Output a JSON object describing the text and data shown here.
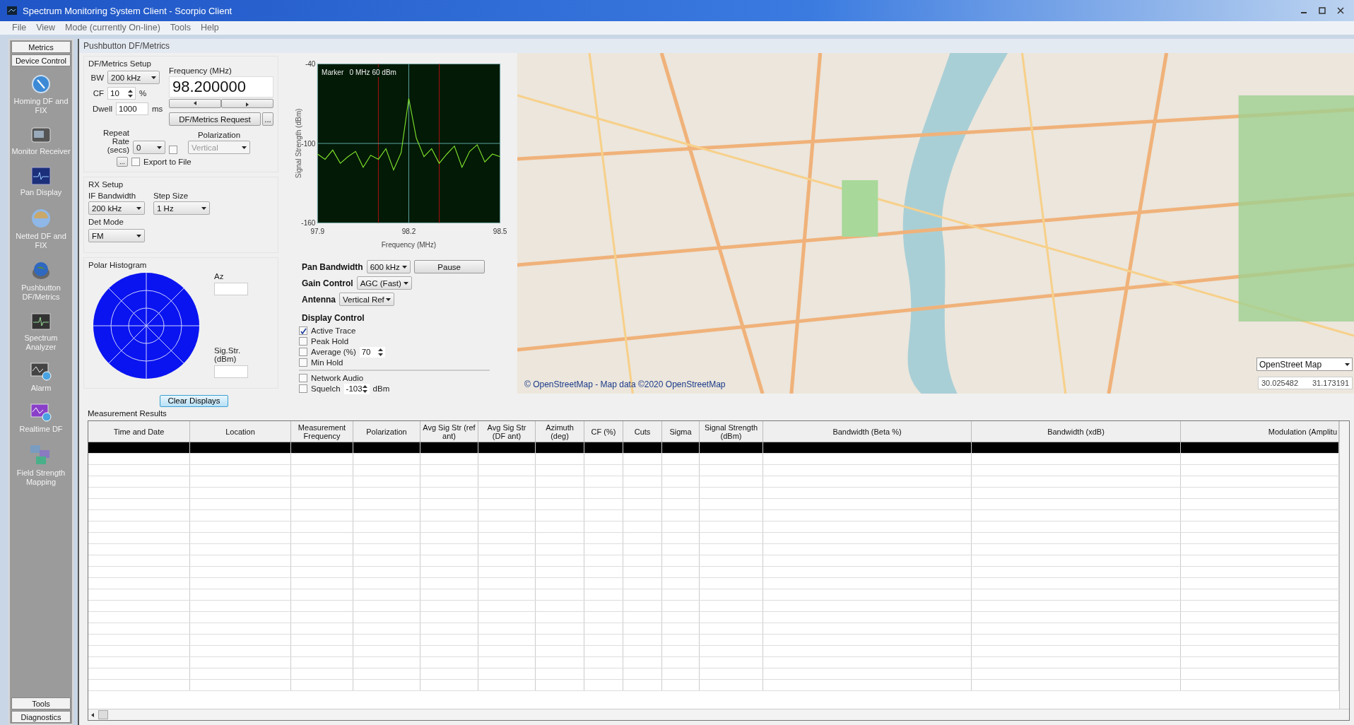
{
  "window": {
    "title": "Spectrum Monitoring System Client - Scorpio Client"
  },
  "menu": [
    "File",
    "View",
    "Mode (currently On-line)",
    "Tools",
    "Help"
  ],
  "sidebar": {
    "top_tabs": [
      "Metrics",
      "Device Control"
    ],
    "items": [
      {
        "label": "Homing DF and FIX"
      },
      {
        "label": "Monitor Receiver"
      },
      {
        "label": "Pan Display"
      },
      {
        "label": "Netted DF and FIX"
      },
      {
        "label": "Pushbutton DF/Metrics"
      },
      {
        "label": "Spectrum Analyzer"
      },
      {
        "label": "Alarm"
      },
      {
        "label": "Realtime DF"
      },
      {
        "label": "Field Strength Mapping"
      }
    ],
    "bottom_tabs": [
      "Tools",
      "Diagnostics"
    ]
  },
  "panel_title": "Pushbutton DF/Metrics",
  "df_setup": {
    "title": "DF/Metrics Setup",
    "bw_label": "BW",
    "bw": "200 kHz",
    "cf_label": "CF",
    "cf": "10",
    "cf_unit": "%",
    "dwell_label": "Dwell",
    "dwell": "1000",
    "dwell_unit": "ms",
    "frequency_label": "Frequency (MHz)",
    "frequency": "98.200000",
    "request_button": "DF/Metrics Request",
    "more_button": "...",
    "repeat_label": "Repeat Rate (secs)",
    "repeat": "0",
    "repeat_checked": false,
    "polarization_label": "Polarization",
    "polarization": "Vertical",
    "polarization_disabled": true,
    "browse_button": "...",
    "export_label": "Export to File",
    "export_checked": false
  },
  "rx_setup": {
    "title": "RX Setup",
    "if_label": "IF Bandwidth",
    "if_bandwidth": "200 kHz",
    "step_label": "Step Size",
    "step": "1 Hz",
    "det_label": "Det Mode",
    "det_mode": "FM"
  },
  "polar_histogram": {
    "title": "Polar Histogram",
    "az_label": "Az",
    "sig_label": "Sig.Str. (dBm)"
  },
  "spectrum": {
    "marker": "Marker   0 MHz 60 dBm",
    "chart_data": {
      "type": "line",
      "xlabel": "Frequency (MHz)",
      "ylabel": "Signal Strength (dBm)",
      "x": [
        97.9,
        97.925,
        97.95,
        97.975,
        98.0,
        98.025,
        98.05,
        98.075,
        98.1,
        98.125,
        98.15,
        98.175,
        98.2,
        98.225,
        98.25,
        98.275,
        98.3,
        98.325,
        98.35,
        98.375,
        98.4,
        98.425,
        98.45,
        98.475,
        98.5
      ],
      "series": [
        {
          "color": "#7ee02c",
          "values": [
            -108,
            -112,
            -105,
            -115,
            -110,
            -106,
            -118,
            -109,
            -112,
            -104,
            -120,
            -107,
            -66,
            -96,
            -110,
            -104,
            -115,
            -108,
            -102,
            -118,
            -106,
            -101,
            -114,
            -108,
            -110
          ]
        }
      ],
      "ref_lines": [
        {
          "axis": "x",
          "value": 98.1,
          "color": "#b01010"
        },
        {
          "axis": "x",
          "value": 98.3,
          "color": "#b01010"
        },
        {
          "axis": "x",
          "value": 98.2,
          "color": "#66aaaa"
        },
        {
          "axis": "y",
          "value": -100,
          "color": "#66aaaa"
        }
      ],
      "xlim": [
        97.9,
        98.5
      ],
      "ylim": [
        -160,
        -40
      ],
      "xticks": [
        97.9,
        98.2,
        98.5
      ],
      "yticks": [
        -160,
        -100,
        -40
      ]
    }
  },
  "pan_controls": [
    {
      "label": "Pan Bandwidth",
      "value": "600 kHz"
    },
    {
      "label": "Gain Control",
      "value": "AGC (Fast)"
    },
    {
      "label": "Antenna",
      "value": "Vertical Ref"
    }
  ],
  "pause_button": "Pause",
  "display_control": {
    "title": "Display Control",
    "options": [
      {
        "kind": "plain",
        "label": "Active Trace",
        "checked": true
      },
      {
        "kind": "plain",
        "label": "Peak Hold",
        "checked": false
      },
      {
        "kind": "spin",
        "label": "Average (%)",
        "checked": false,
        "value": "70"
      },
      {
        "kind": "plain",
        "label": "Min Hold",
        "checked": false
      },
      {
        "kind": "plain",
        "label": "Network Audio",
        "checked": false
      },
      {
        "kind": "spin",
        "label": "Squelch",
        "checked": false,
        "value": "-103",
        "unit": "dBm"
      }
    ]
  },
  "map": {
    "attribution": "© OpenStreetMap - Map data ©2020 OpenStreetMap",
    "layer": "OpenStreet Map",
    "lat": "30.025482",
    "lon": "31.173191"
  },
  "clear_button": "Clear Displays",
  "results": {
    "title": "Measurement Results",
    "columns": [
      "Time and Date",
      "Location",
      "Measurement Frequency",
      "Polarization",
      "Avg Sig Str (ref ant)",
      "Avg Sig Str (DF ant)",
      "Azimuth (deg)",
      "CF (%)",
      "Cuts",
      "Sigma",
      "Signal Strength (dBm)",
      "Bandwidth (Beta %)",
      "Bandwidth (xdB)",
      "Modulation (Amplitu"
    ],
    "rows": [
      {
        "selected": true
      }
    ]
  }
}
